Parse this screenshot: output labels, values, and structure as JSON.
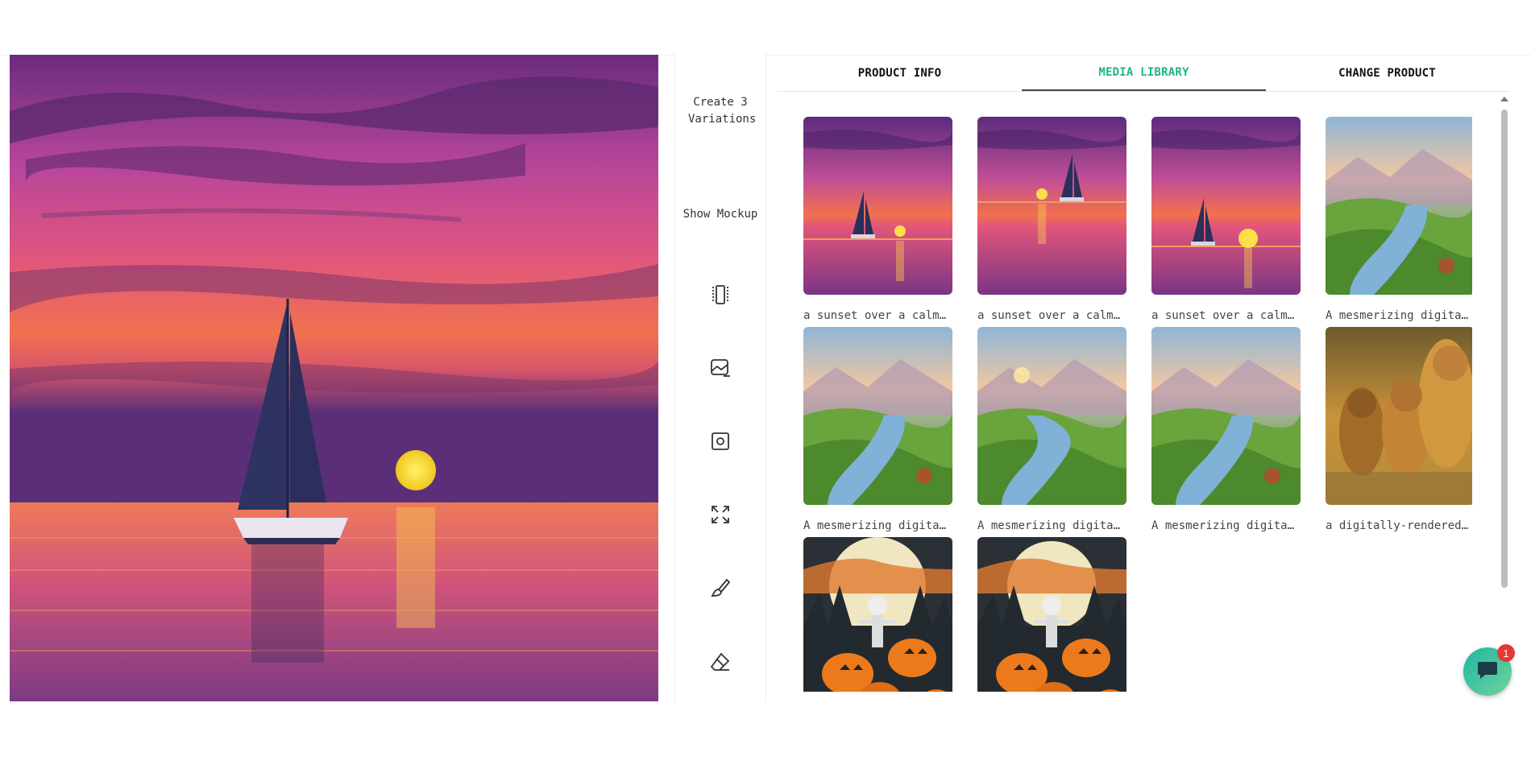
{
  "toolbar": {
    "create_variations_label": "Create 3 Variations",
    "show_mockup_label": "Show Mockup",
    "icons": [
      "split-icon",
      "image-edit-icon",
      "frame-icon",
      "expand-icon",
      "brush-icon",
      "eraser-icon"
    ]
  },
  "tabs": [
    {
      "label": "PRODUCT INFO",
      "active": false
    },
    {
      "label": "MEDIA LIBRARY",
      "active": true
    },
    {
      "label": "CHANGE PRODUCT",
      "active": false
    }
  ],
  "media": [
    {
      "caption": "a sunset over a calm o…",
      "kind": "sunset1"
    },
    {
      "caption": "a sunset over a calm o…",
      "kind": "sunset2"
    },
    {
      "caption": "a sunset over a calm o…",
      "kind": "sunset3"
    },
    {
      "caption": "A mesmerizing digital …",
      "kind": "valley1"
    },
    {
      "caption": "A mesmerizing digital …",
      "kind": "valley2"
    },
    {
      "caption": "A mesmerizing digital …",
      "kind": "valley3"
    },
    {
      "caption": "A mesmerizing digital …",
      "kind": "valley4"
    },
    {
      "caption": "a digitally-rendered p…",
      "kind": "lions"
    },
    {
      "caption": "",
      "kind": "halloween1"
    },
    {
      "caption": "",
      "kind": "halloween2"
    }
  ],
  "chat": {
    "badge_count": "1"
  },
  "colors": {
    "accent": "#1fb482",
    "badge": "#e53935"
  }
}
